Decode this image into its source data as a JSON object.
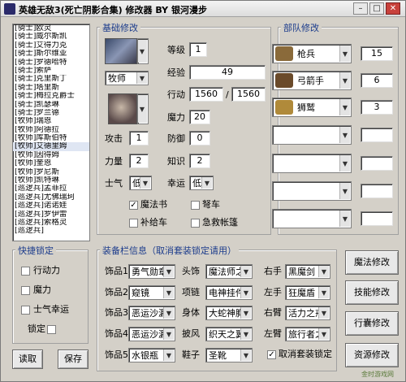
{
  "window": {
    "title": "英雄无敌3(死亡阴影合集) 修改器 BY 银河漫步"
  },
  "hero_list": [
    "[骑士]欧灵",
    "[骑士]威尔斯凯",
    "[骑士]艾得力克",
    "[骑士]斯尔维亚",
    "[骑士]罗德哈特",
    "[骑士]索萨",
    "[骑士]克里斯丁",
    "[骑士]塔里斯",
    "[骑士]梅拉克爵士",
    "[骑士]凯瑟琳",
    "[骑士]罗兰德",
    "[牧师]瑞恩",
    "[牧师]阿德拉",
    "[牧师]库斯伯特",
    "[牧师]艾德里姆",
    "[牧师]因得姆",
    "[牧师]奎恩",
    "[牧师]罗尼斯",
    "[牧师]凯特琳",
    "[巡逻兵]孟菲拉",
    "[巡逻兵]尤佛瑞珂",
    "[巡逻兵]诺诺娃",
    "[巡逻兵]罗伊雷",
    "[巡逻兵]索格灵",
    "[巡逻兵]"
  ],
  "basic": {
    "group_label": "基础修改",
    "hero_class": "牧师",
    "level_label": "等级",
    "level": "1",
    "exp_label": "经验",
    "exp": "49",
    "move_label": "行动",
    "move_cur": "1560",
    "move_sep": "/",
    "move_max": "1560",
    "mana_label": "魔力",
    "mana": "20",
    "attack_label": "攻击",
    "attack": "1",
    "defense_label": "防御",
    "defense": "0",
    "power_label": "力量",
    "power": "2",
    "knowledge_label": "知识",
    "knowledge": "2",
    "morale_label": "士气",
    "morale": "低",
    "luck_label": "幸运",
    "luck": "低",
    "spellbook": "魔法书",
    "ballista": "弩车",
    "ammo_cart": "补给车",
    "first_aid": "急救帐篷"
  },
  "army": {
    "group_label": "部队修改",
    "slots": [
      {
        "name": "枪兵",
        "count": "15"
      },
      {
        "name": "弓箭手",
        "count": "6"
      },
      {
        "name": "狮鹫",
        "count": "3"
      },
      {
        "name": "",
        "count": ""
      },
      {
        "name": "",
        "count": ""
      },
      {
        "name": "",
        "count": ""
      },
      {
        "name": "",
        "count": ""
      }
    ]
  },
  "quick_lock": {
    "group_label": "快捷锁定",
    "move": "行动力",
    "mana": "魔力",
    "morale_luck": "士气幸运",
    "lock": "锁定"
  },
  "buttons": {
    "load": "读取",
    "save": "保存",
    "magic": "魔法修改",
    "skill": "技能修改",
    "backpack": "行囊修改",
    "resource": "资源修改"
  },
  "equipment": {
    "group_label": "装备栏信息（取消套装锁定请用）",
    "rows": [
      [
        {
          "label": "饰品1",
          "value": "勇气勋章"
        },
        {
          "label": "头饰",
          "value": "魔法师之帽"
        },
        {
          "label": "右手",
          "value": "黑魔剑"
        }
      ],
      [
        {
          "label": "饰品2",
          "value": "窥镜"
        },
        {
          "label": "项链",
          "value": "电神挂件"
        },
        {
          "label": "左手",
          "value": "狂魔盾"
        }
      ],
      [
        {
          "label": "饰品3",
          "value": "恶运沙漏"
        },
        {
          "label": "身体",
          "value": "大蛇神胸甲"
        },
        {
          "label": "右臂",
          "value": "活力之戒"
        }
      ],
      [
        {
          "label": "饰品4",
          "value": "恶运沙漏"
        },
        {
          "label": "披风",
          "value": "织天之翼"
        },
        {
          "label": "左臂",
          "value": "旅行者之戒"
        }
      ],
      [
        {
          "label": "饰品5",
          "value": "水银瓶"
        },
        {
          "label": "鞋子",
          "value": "圣靴"
        }
      ]
    ],
    "cancel_set_lock": "取消套装锁定"
  },
  "watermark": "金时游戏网"
}
